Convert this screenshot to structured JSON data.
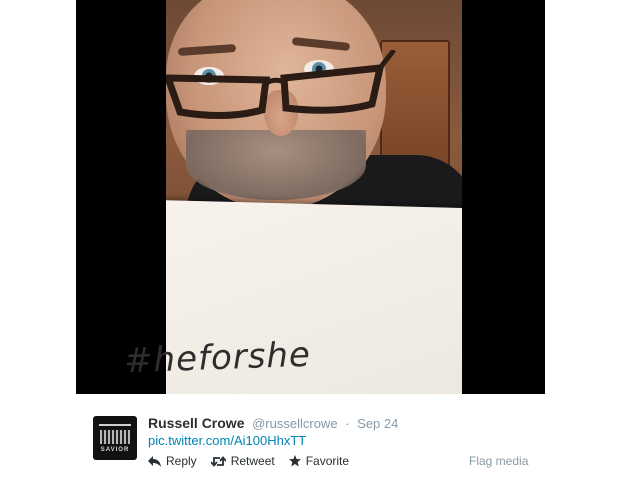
{
  "media": {
    "hashtag_text": "#heforshe"
  },
  "tweet": {
    "avatar_text": "SAVIOR",
    "fullname": "Russell Crowe",
    "screenname": "@russellcrowe",
    "separator": "·",
    "time": "Sep 24",
    "link": "pic.twitter.com/Ai100HhxTT",
    "actions": {
      "reply": "Reply",
      "retweet": "Retweet",
      "favorite": "Favorite"
    },
    "flag": "Flag media"
  },
  "colors": {
    "link": "#0084b4",
    "muted": "#8899a6",
    "text": "#292f33",
    "frame": "#000000"
  }
}
